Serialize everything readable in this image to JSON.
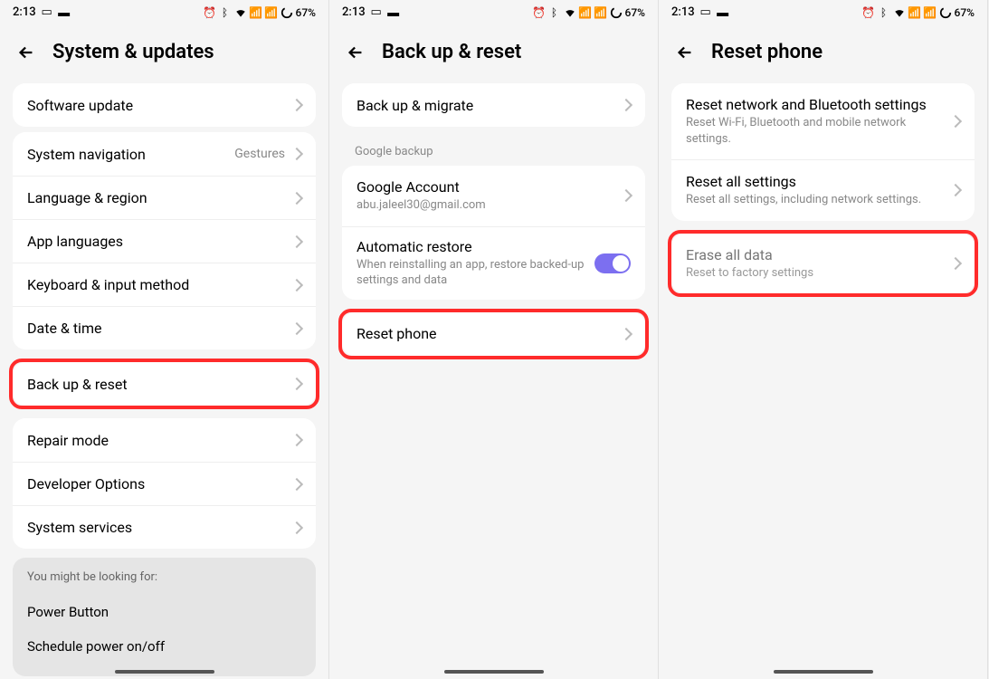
{
  "statusBar": {
    "time": "2:13",
    "battery": "67%"
  },
  "screen1": {
    "title": "System & updates",
    "items": {
      "softwareUpdate": "Software update",
      "systemNavigation": "System navigation",
      "systemNavigationValue": "Gestures",
      "languageRegion": "Language & region",
      "appLanguages": "App languages",
      "keyboardInput": "Keyboard & input method",
      "dateTime": "Date & time",
      "backupReset": "Back up & reset",
      "repairMode": "Repair mode",
      "developerOptions": "Developer Options",
      "systemServices": "System services"
    },
    "suggestions": {
      "header": "You might be looking for:",
      "powerButton": "Power Button",
      "schedulePower": "Schedule power on/off"
    }
  },
  "screen2": {
    "title": "Back up & reset",
    "backupMigrate": "Back up & migrate",
    "googleBackupLabel": "Google backup",
    "googleAccount": "Google Account",
    "googleEmail": "abu.jaleel30@gmail.com",
    "autoRestore": "Automatic restore",
    "autoRestoreDesc": "When reinstalling an app, restore backed-up settings and data",
    "resetPhone": "Reset phone"
  },
  "screen3": {
    "title": "Reset phone",
    "resetNetwork": "Reset network and Bluetooth settings",
    "resetNetworkDesc": "Reset Wi-Fi, Bluetooth and mobile network settings.",
    "resetAll": "Reset all settings",
    "resetAllDesc": "Reset all settings, including network settings.",
    "eraseAll": "Erase all data",
    "eraseAllDesc": "Reset to factory settings"
  }
}
